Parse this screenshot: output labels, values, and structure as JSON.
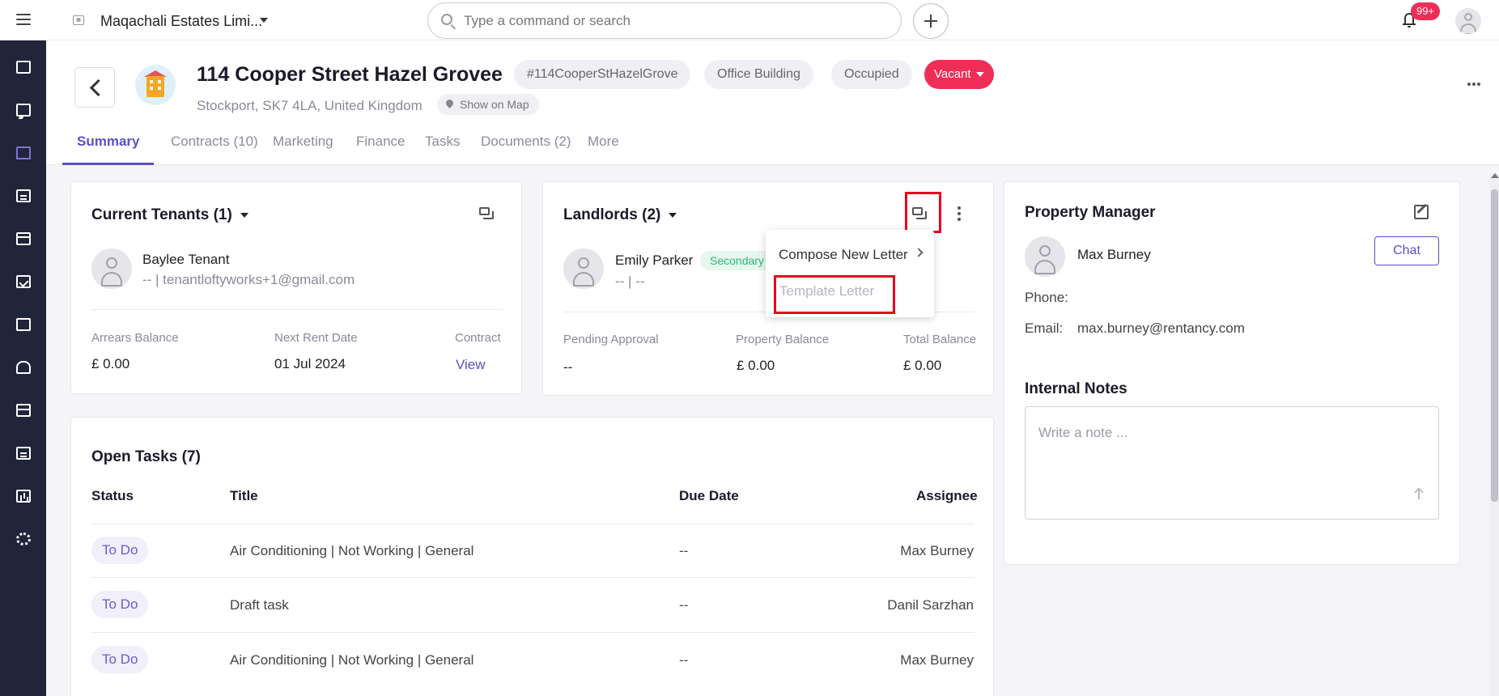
{
  "topbar": {
    "company": "Maqachali Estates Limi...",
    "search_placeholder": "Type a command or search",
    "notification_count": "99+"
  },
  "sidebar": {
    "items": [
      {
        "icon": "dashboard-icon"
      },
      {
        "icon": "messages-icon"
      },
      {
        "icon": "properties-icon",
        "active": true
      },
      {
        "icon": "tenancies-icon"
      },
      {
        "icon": "calendar-icon"
      },
      {
        "icon": "tasks-icon"
      },
      {
        "icon": "contacts-icon"
      },
      {
        "icon": "people-icon"
      },
      {
        "icon": "bank-icon"
      },
      {
        "icon": "documents-icon"
      },
      {
        "icon": "reports-icon"
      },
      {
        "icon": "settings-icon"
      }
    ]
  },
  "property": {
    "title": "114 Cooper Street Hazel Grovee",
    "address": "Stockport, SK7 4LA, United Kingdom",
    "show_on_map": "Show on Map",
    "tags": [
      "#114CooperStHazelGrove",
      "Office Building",
      "Occupied"
    ],
    "status": "Vacant"
  },
  "tabs": [
    "Summary",
    "Contracts (10)",
    "Marketing",
    "Finance",
    "Tasks",
    "Documents (2)",
    "More"
  ],
  "tenants": {
    "title": "Current Tenants (1)",
    "name": "Baylee Tenant",
    "contact": "-- | tenantloftyworks+1@gmail.com",
    "arrears_label": "Arrears Balance",
    "arrears_value": "£ 0.00",
    "next_rent_label": "Next Rent Date",
    "next_rent_value": "01 Jul 2024",
    "contract_label": "Contract",
    "contract_link": "View"
  },
  "landlords": {
    "title": "Landlords (2)",
    "name": "Emily Parker",
    "badge": "Secondary",
    "contact": "-- | --",
    "pending_label": "Pending Approval",
    "pending_value": "--",
    "property_balance_label": "Property Balance",
    "property_balance_value": "£ 0.00",
    "total_balance_label": "Total Balance",
    "total_balance_value": "£ 0.00"
  },
  "dropdown": {
    "compose": "Compose New Letter",
    "template": "Template Letter"
  },
  "manager": {
    "title": "Property Manager",
    "name": "Max Burney",
    "chat": "Chat",
    "phone_label": "Phone:",
    "email_label": "Email:",
    "email_value": "max.burney@rentancy.com"
  },
  "notes": {
    "title": "Internal Notes",
    "placeholder": "Write a note ..."
  },
  "tasks": {
    "title": "Open Tasks (7)",
    "headers": {
      "status": "Status",
      "title": "Title",
      "due": "Due Date",
      "assignee": "Assignee"
    },
    "rows": [
      {
        "status": "To Do",
        "title": "Air Conditioning | Not Working | General",
        "due": "--",
        "assignee": "Max Burney"
      },
      {
        "status": "To Do",
        "title": "Draft task",
        "due": "--",
        "assignee": "Danil Sarzhan"
      },
      {
        "status": "To Do",
        "title": "Air Conditioning | Not Working | General",
        "due": "--",
        "assignee": "Max Burney"
      }
    ]
  }
}
